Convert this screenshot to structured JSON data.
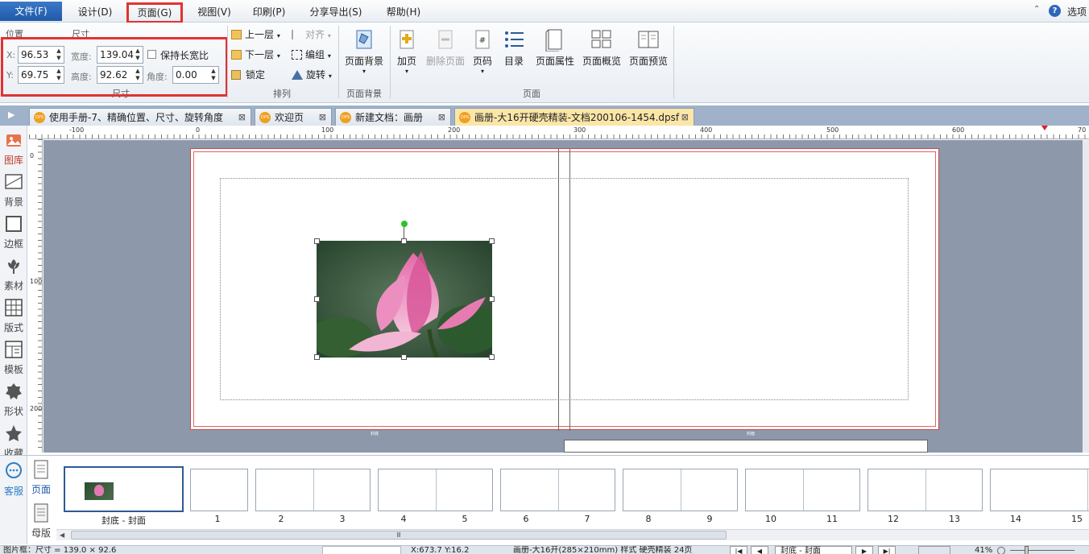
{
  "menu": {
    "file": "文件(F)",
    "design": "设计(D)",
    "page": "页面(G)",
    "view": "视图(V)",
    "print": "印刷(P)",
    "share": "分享导出(S)",
    "help": "帮助(H)",
    "options": "选项"
  },
  "ribbon": {
    "position_label": "位置",
    "size_label": "尺寸",
    "x_label": "X:",
    "x_value": "96.53",
    "y_label": "Y:",
    "y_value": "69.75",
    "width_label": "宽度:",
    "width_value": "139.04",
    "height_label": "高度:",
    "height_value": "92.62",
    "keep_ratio": "保持长宽比",
    "angle_label": "角度:",
    "angle_value": "0.00",
    "group_size": "尺寸",
    "up_layer": "上一层",
    "down_layer": "下一层",
    "lock": "锁定",
    "align": "对齐",
    "group": "编组",
    "rotate": "旋转",
    "group_arrange": "排列",
    "page_bg": "页面背景",
    "group_page_bg": "页面背景",
    "add_page": "加页",
    "delete_page": "删除页面",
    "page_number": "页码",
    "toc": "目录",
    "page_props": "页面属性",
    "page_overview": "页面概览",
    "page_preview": "页面预览",
    "group_page": "页面"
  },
  "tabs": [
    {
      "label": "使用手册-7、精确位置、尺寸、旋转角度"
    },
    {
      "label": "欢迎页"
    },
    {
      "label": "新建文档：画册"
    },
    {
      "label": "画册-大16开硬壳精装-文档200106-1454.dpsf"
    }
  ],
  "ruler": {
    "h": [
      "-100",
      "0",
      "100",
      "200",
      "300",
      "400",
      "500",
      "600",
      "70"
    ],
    "v": [
      "0",
      "100",
      "200"
    ]
  },
  "lefttools": {
    "gallery": "图库",
    "background": "背景",
    "border": "边框",
    "material": "素材",
    "layout": "版式",
    "template": "模板",
    "shape": "形状",
    "favorite": "收藏",
    "service": "客服"
  },
  "canvas": {
    "left_caption": "封底",
    "right_caption": "封面"
  },
  "strip": {
    "page_tab": "页面",
    "master_tab": "母版",
    "cover_label": "封底 - 封面",
    "numbers": [
      "1",
      "2",
      "3",
      "4",
      "5",
      "6",
      "7",
      "8",
      "9",
      "10",
      "11",
      "12",
      "13",
      "14",
      "15"
    ],
    "scroll_center": "Ⅲ"
  },
  "status": {
    "selection": "图片框：尺寸 = 139.0 × 92.6",
    "coords": "X:673.7 Y:16.2",
    "doc_info": "画册-大16开(285×210mm) 样式 硬壳精装 24页",
    "page_select": "封底 - 封面",
    "zoom": "41%"
  },
  "colors": {
    "accent": "#1e5aa8",
    "highlight_box": "#e23232",
    "active_tab": "#fbe6a8",
    "canvas_bg": "#8d98ab"
  }
}
